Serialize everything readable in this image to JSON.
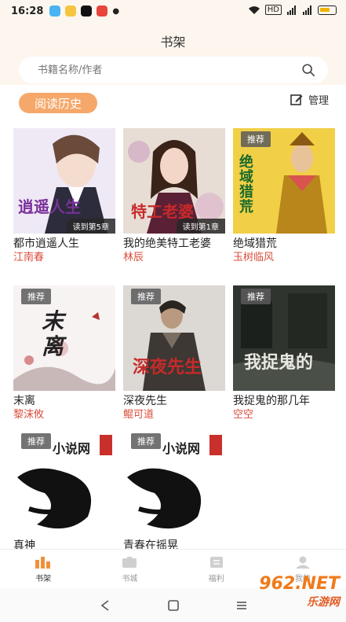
{
  "status_bar": {
    "time": "16:28"
  },
  "header": {
    "title": "书架"
  },
  "search": {
    "placeholder": "书籍名称/作者"
  },
  "section": {
    "tab_label": "阅读历史",
    "manage_label": "管理"
  },
  "books": [
    {
      "title": "都市逍遥人生",
      "author": "江南春",
      "progress": "读到第5章",
      "badge": "",
      "cover_text": "逍遥人生",
      "cover_color": "#f4f1fb"
    },
    {
      "title": "我的绝美特工老婆",
      "author": "林辰",
      "progress": "读到第1章",
      "badge": "",
      "cover_text": "特工老婆",
      "cover_color": "#e8ddd6"
    },
    {
      "title": "绝域猎荒",
      "author": "玉树临风",
      "progress": "",
      "badge": "推荐",
      "cover_text": "绝域猎荒",
      "cover_color": "#f2d34c"
    },
    {
      "title": "末离",
      "author": "黎沫攸",
      "progress": "",
      "badge": "推荐",
      "cover_text": "末离",
      "cover_color": "#f7f3f3"
    },
    {
      "title": "深夜先生",
      "author": "鲲可道",
      "progress": "",
      "badge": "推荐",
      "cover_text": "深夜先生",
      "cover_color": "#d9d6d2"
    },
    {
      "title": "我捉鬼的那几年",
      "author": "空空",
      "progress": "",
      "badge": "推荐",
      "cover_text": "我捉鬼的",
      "cover_color": "#3a4038"
    },
    {
      "title": "真神",
      "author": "",
      "progress": "",
      "badge": "推荐",
      "cover_text": "小说网",
      "cover_color": "#ffffff"
    },
    {
      "title": "青春在摇晃",
      "author": "",
      "progress": "",
      "badge": "推荐",
      "cover_text": "小说网",
      "cover_color": "#ffffff"
    }
  ],
  "tabbar": [
    {
      "label": "书架",
      "icon": "bookshelf-icon",
      "active": true
    },
    {
      "label": "书城",
      "icon": "bookstore-icon",
      "active": false
    },
    {
      "label": "福利",
      "icon": "welfare-icon",
      "active": false
    },
    {
      "label": "我的",
      "icon": "profile-icon",
      "active": false
    }
  ],
  "watermark": {
    "text": "962.NET",
    "sub": "乐游网"
  },
  "colors": {
    "accent": "#f5a86a",
    "author": "#d94c3b",
    "header_bg": "#fdf6ee"
  }
}
